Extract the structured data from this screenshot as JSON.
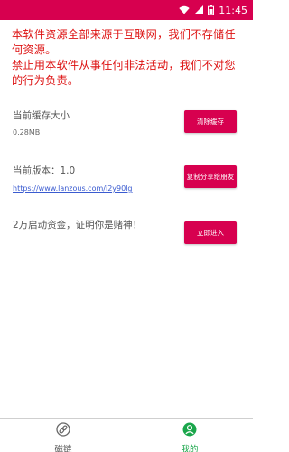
{
  "status_bar": {
    "time": "11:45",
    "icons": [
      "wifi-icon",
      "signal-icon",
      "battery-icon"
    ]
  },
  "disclaimer": {
    "line1": "本软件资源全部来源于互联网，我们不存储任何资源。",
    "line2": "禁止用本软件从事任何非法活动，我们不对您的行为负责。",
    "color": "#dd1111"
  },
  "cache": {
    "label": "当前缓存大小",
    "value": "0.28MB",
    "button": "清除缓存"
  },
  "version": {
    "label": "当前版本：1.0",
    "link": "https://www.lanzous.com/i2y90lg",
    "button": "复制分享给朋友"
  },
  "fund": {
    "label": "2万启动资金，证明你是赌神！",
    "button": "立即进入"
  },
  "nav": {
    "items": [
      {
        "label": "磁链",
        "icon": "link-icon",
        "active": false
      },
      {
        "label": "我的",
        "icon": "user-icon",
        "active": true
      }
    ]
  },
  "colors": {
    "accent": "#d7004f",
    "nav_active": "#1aa64b"
  }
}
